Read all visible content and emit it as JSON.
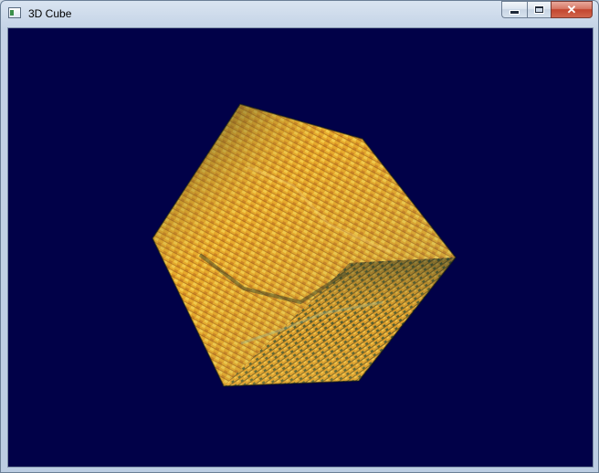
{
  "window": {
    "title": "3D Cube",
    "icon": "app-window-icon",
    "controls": {
      "minimize_icon": "minimize-icon",
      "maximize_icon": "maximize-icon",
      "close_icon": "close-icon",
      "close_glyph": "✕"
    }
  },
  "viewport": {
    "background_color": "#010148",
    "object": "textured-cube",
    "texture_colors": [
      "#f2c23a",
      "#e4a227",
      "#9a4a12",
      "#3a4a30",
      "#1c2418",
      "#7aa080"
    ]
  }
}
